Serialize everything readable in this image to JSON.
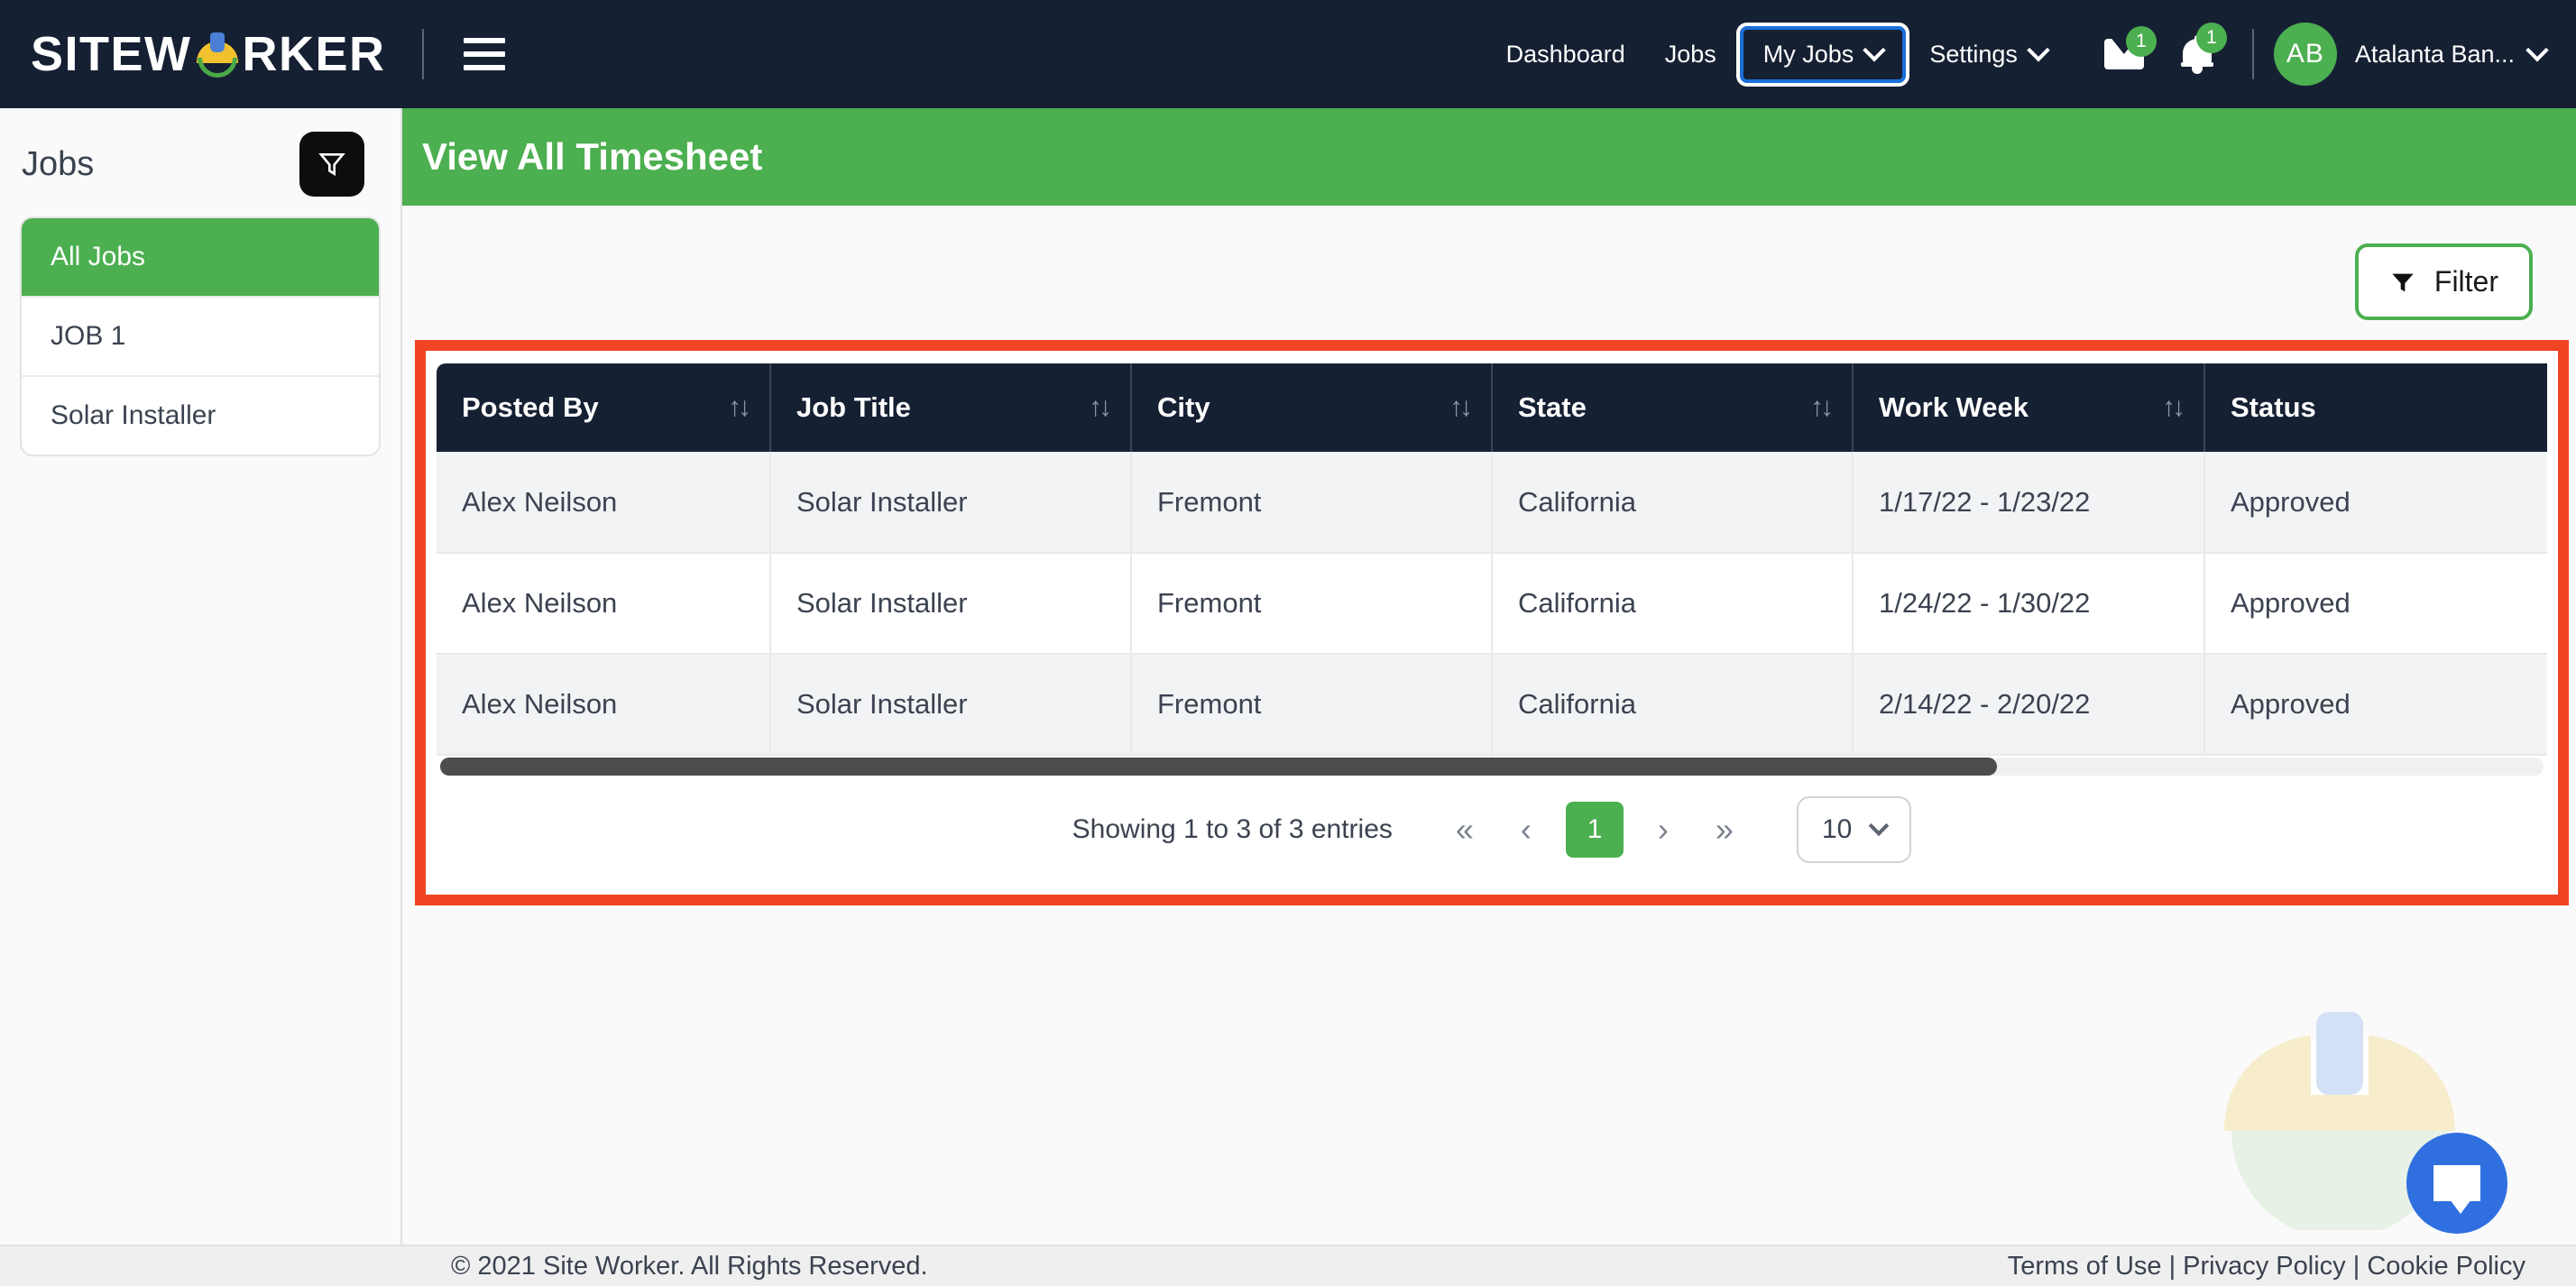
{
  "brand": {
    "name": "SITEWORKER",
    "logo_icon": "hardhat-icon"
  },
  "topnav": {
    "menu_icon": "hamburger-icon",
    "links": [
      {
        "label": "Dashboard",
        "has_caret": false,
        "active": false
      },
      {
        "label": "Jobs",
        "has_caret": false,
        "active": false
      },
      {
        "label": "My Jobs",
        "has_caret": true,
        "active": true
      },
      {
        "label": "Settings",
        "has_caret": true,
        "active": false
      }
    ],
    "mail": {
      "icon": "mail-icon",
      "badge": "1"
    },
    "notifications": {
      "icon": "bell-icon",
      "badge": "1"
    },
    "user": {
      "initials": "AB",
      "name": "Atalanta Ban..."
    }
  },
  "sidebar": {
    "title": "Jobs",
    "filter_icon": "filter-funnel-icon",
    "items": [
      {
        "label": "All Jobs",
        "selected": true
      },
      {
        "label": "JOB 1",
        "selected": false
      },
      {
        "label": "Solar Installer",
        "selected": false
      }
    ]
  },
  "page": {
    "title": "View All Timesheet"
  },
  "toolbar": {
    "filter_label": "Filter",
    "filter_icon": "funnel-icon"
  },
  "table": {
    "sort_icon": "sort-updown-icon",
    "columns": [
      {
        "label": "Posted By",
        "sortable": true
      },
      {
        "label": "Job Title",
        "sortable": true
      },
      {
        "label": "City",
        "sortable": true
      },
      {
        "label": "State",
        "sortable": true
      },
      {
        "label": "Work Week",
        "sortable": true
      },
      {
        "label": "Status",
        "sortable": false
      }
    ],
    "rows": [
      {
        "posted_by": "Alex Neilson",
        "job_title": "Solar Installer",
        "city": "Fremont",
        "state": "California",
        "work_week": "1/17/22 - 1/23/22",
        "status": "Approved"
      },
      {
        "posted_by": "Alex Neilson",
        "job_title": "Solar Installer",
        "city": "Fremont",
        "state": "California",
        "work_week": "1/24/22 - 1/30/22",
        "status": "Approved"
      },
      {
        "posted_by": "Alex Neilson",
        "job_title": "Solar Installer",
        "city": "Fremont",
        "state": "California",
        "work_week": "2/14/22 - 2/20/22",
        "status": "Approved"
      }
    ]
  },
  "pagination": {
    "info": "Showing 1 to 3 of 3 entries",
    "first": "«",
    "prev": "‹",
    "current_page": "1",
    "next": "›",
    "last": "»",
    "page_size": "10"
  },
  "chat": {
    "icon": "chat-bubble-icon"
  },
  "watermark": {
    "icon": "hardhat-watermark-icon"
  },
  "footer": {
    "copyright": "© 2021 Site Worker. All Rights Reserved.",
    "links": "Terms of Use | Privacy Policy | Cookie Policy"
  },
  "colors": {
    "navy": "#162033",
    "green": "#4caf50",
    "highlight_red": "#f04423",
    "focus_blue": "#1a6fdb",
    "chat_blue": "#2f6fe0"
  }
}
